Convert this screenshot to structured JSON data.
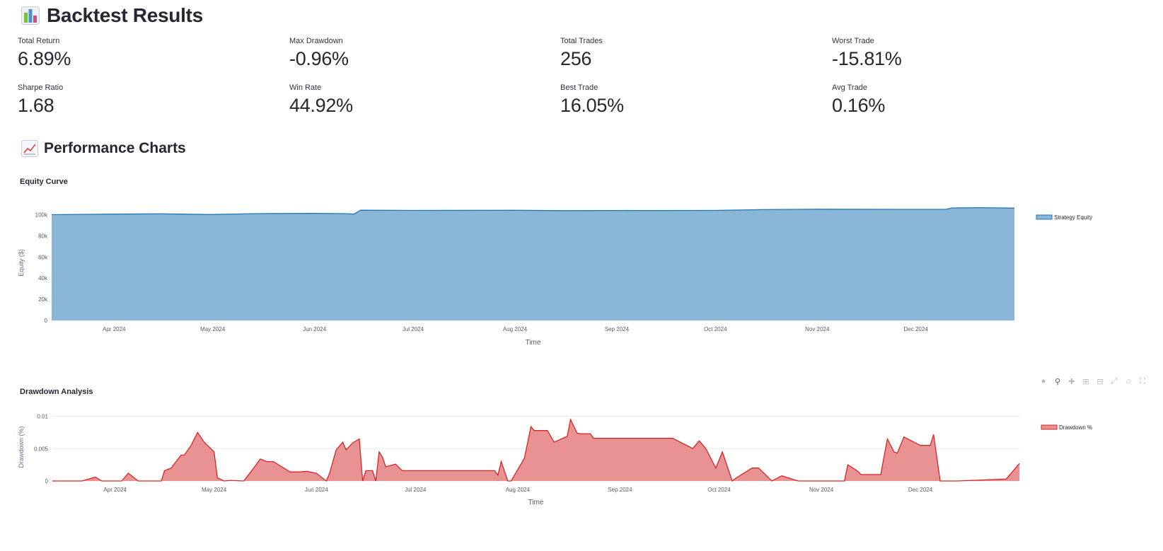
{
  "page": {
    "title": "Backtest Results",
    "title_icon": "bar-chart-emoji-icon",
    "section_title": "Performance Charts",
    "section_icon": "line-chart-emoji-icon"
  },
  "metrics": [
    {
      "label": "Total Return",
      "value": "6.89%"
    },
    {
      "label": "Max Drawdown",
      "value": "-0.96%"
    },
    {
      "label": "Total Trades",
      "value": "256"
    },
    {
      "label": "Worst Trade",
      "value": "-15.81%"
    },
    {
      "label": "Sharpe Ratio",
      "value": "1.68"
    },
    {
      "label": "Win Rate",
      "value": "44.92%"
    },
    {
      "label": "Best Trade",
      "value": "16.05%"
    },
    {
      "label": "Avg Trade",
      "value": "0.16%"
    }
  ],
  "modebar": [
    "camera-icon",
    "zoom-icon",
    "pan-icon",
    "zoom-in-icon",
    "zoom-out-icon",
    "autoscale-icon",
    "reset-home-icon",
    "fullscreen-icon"
  ],
  "chart_data": [
    {
      "type": "area",
      "title": "Equity Curve",
      "xlabel": "Time",
      "ylabel": "Equity ($)",
      "color": "#1f77b4",
      "fill": "#8ab7d8",
      "ylim": [
        0,
        109000
      ],
      "yticks": [
        "0",
        "20k",
        "40k",
        "60k",
        "80k",
        "100k"
      ],
      "yticks_values": [
        0,
        20000,
        40000,
        60000,
        80000,
        100000
      ],
      "xticks": [
        "Apr 2024",
        "May 2024",
        "Jun 2024",
        "Jul 2024",
        "Aug 2024",
        "Sep 2024",
        "Oct 2024",
        "Nov 2024",
        "Dec 2024"
      ],
      "xticks_dates": [
        "2024-04-01",
        "2024-05-01",
        "2024-06-01",
        "2024-07-01",
        "2024-08-01",
        "2024-09-01",
        "2024-10-01",
        "2024-11-01",
        "2024-12-01"
      ],
      "xrange": [
        "2024-03-13",
        "2024-12-31"
      ],
      "legend": "top-right",
      "series": [
        {
          "name": "Strategy Equity",
          "x": [
            "2024-03-13",
            "2024-04-01",
            "2024-04-15",
            "2024-04-30",
            "2024-05-15",
            "2024-06-01",
            "2024-06-10",
            "2024-06-13",
            "2024-06-15",
            "2024-07-01",
            "2024-08-01",
            "2024-08-15",
            "2024-09-01",
            "2024-10-01",
            "2024-10-15",
            "2024-11-01",
            "2024-12-01",
            "2024-12-10",
            "2024-12-12",
            "2024-12-20",
            "2024-12-31"
          ],
          "y": [
            100000,
            100500,
            100800,
            100100,
            101000,
            101200,
            101000,
            100500,
            104200,
            104000,
            104100,
            103800,
            103900,
            104000,
            104700,
            105100,
            105000,
            105000,
            106300,
            106600,
            106200
          ]
        }
      ]
    },
    {
      "type": "area",
      "title": "Drawdown Analysis",
      "xlabel": "Time",
      "ylabel": "Drawdown (%)",
      "color": "#d62728",
      "fill": "#e99293",
      "ylim": [
        0,
        0.0105
      ],
      "yticks": [
        "0",
        "0.005",
        "0.01"
      ],
      "yticks_values": [
        0,
        0.005,
        0.01
      ],
      "xticks": [
        "Apr 2024",
        "May 2024",
        "Jun 2024",
        "Jul 2024",
        "Aug 2024",
        "Sep 2024",
        "Oct 2024",
        "Nov 2024",
        "Dec 2024"
      ],
      "xticks_dates": [
        "2024-04-01",
        "2024-05-01",
        "2024-06-01",
        "2024-07-01",
        "2024-08-01",
        "2024-09-01",
        "2024-10-01",
        "2024-11-01",
        "2024-12-01"
      ],
      "xrange": [
        "2024-03-13",
        "2024-12-31"
      ],
      "legend": "top-right",
      "series": [
        {
          "name": "Drawdown %",
          "x": [
            "2024-03-13",
            "2024-03-22",
            "2024-03-26",
            "2024-03-28",
            "2024-04-03",
            "2024-04-05",
            "2024-04-08",
            "2024-04-15",
            "2024-04-16",
            "2024-04-18",
            "2024-04-21",
            "2024-04-22",
            "2024-04-24",
            "2024-04-26",
            "2024-04-28",
            "2024-05-01",
            "2024-05-02",
            "2024-05-04",
            "2024-05-06",
            "2024-05-10",
            "2024-05-13",
            "2024-05-15",
            "2024-05-17",
            "2024-05-19",
            "2024-05-24",
            "2024-05-27",
            "2024-05-29",
            "2024-05-31",
            "2024-06-01",
            "2024-06-04",
            "2024-06-05",
            "2024-06-07",
            "2024-06-09",
            "2024-06-10",
            "2024-06-12",
            "2024-06-14",
            "2024-06-15",
            "2024-06-16",
            "2024-06-18",
            "2024-06-19",
            "2024-06-20",
            "2024-06-21",
            "2024-06-22",
            "2024-06-25",
            "2024-06-27",
            "2024-06-28",
            "2024-06-30",
            "2024-07-02",
            "2024-07-25",
            "2024-07-26",
            "2024-07-27",
            "2024-07-29",
            "2024-07-30",
            "2024-08-03",
            "2024-08-05",
            "2024-08-06",
            "2024-08-10",
            "2024-08-12",
            "2024-08-16",
            "2024-08-17",
            "2024-08-19",
            "2024-08-20",
            "2024-08-23",
            "2024-08-24",
            "2024-09-01",
            "2024-09-10",
            "2024-09-17",
            "2024-09-20",
            "2024-09-22",
            "2024-09-23",
            "2024-09-25",
            "2024-09-27",
            "2024-09-30",
            "2024-10-02",
            "2024-10-05",
            "2024-10-06",
            "2024-10-11",
            "2024-10-12",
            "2024-10-13",
            "2024-10-17",
            "2024-10-20",
            "2024-10-25",
            "2024-11-02",
            "2024-11-05",
            "2024-11-08",
            "2024-11-09",
            "2024-11-10",
            "2024-11-12",
            "2024-11-13",
            "2024-11-16",
            "2024-11-19",
            "2024-11-20",
            "2024-11-21",
            "2024-11-23",
            "2024-11-24",
            "2024-11-26",
            "2024-12-01",
            "2024-12-02",
            "2024-12-04",
            "2024-12-05",
            "2024-12-07",
            "2024-12-10",
            "2024-12-11",
            "2024-12-12",
            "2024-12-27",
            "2024-12-31"
          ],
          "y": [
            0,
            0,
            0.0006,
            0,
            0,
            0.0012,
            0,
            0,
            0.0016,
            0.002,
            0.004,
            0.004,
            0.0055,
            0.0075,
            0.006,
            0.0045,
            0.0005,
            0,
            0.0001,
            0,
            0.002,
            0.0034,
            0.003,
            0.003,
            0.0014,
            0.0014,
            0.0015,
            0.0013,
            0.0012,
            0,
            0.0012,
            0.0048,
            0.006,
            0.0048,
            0.0059,
            0.0065,
            0,
            0.0016,
            0.0016,
            0,
            0.0045,
            0.0037,
            0.0022,
            0.0026,
            0.0016,
            0.0016,
            0.0016,
            0.0016,
            0.0016,
            0.0009,
            0.003,
            0,
            0,
            0.0035,
            0.0084,
            0.0078,
            0.0078,
            0.006,
            0.0069,
            0.0095,
            0.0074,
            0.0073,
            0.0073,
            0.0066,
            0.0066,
            0.0066,
            0.0066,
            0.0058,
            0.0053,
            0.005,
            0.0062,
            0.005,
            0.002,
            0.0045,
            0,
            0.0004,
            0.002,
            0.002,
            0.002,
            0,
            0.0008,
            0,
            0,
            0,
            0,
            0.0025,
            0.0022,
            0.0015,
            0.001,
            0.001,
            0.001,
            0.0038,
            0.0065,
            0.0045,
            0.0043,
            0.0068,
            0.0055,
            0.0055,
            0.0055,
            0.0072,
            0,
            0,
            0,
            0,
            0.0003,
            0.0027
          ]
        }
      ]
    }
  ]
}
